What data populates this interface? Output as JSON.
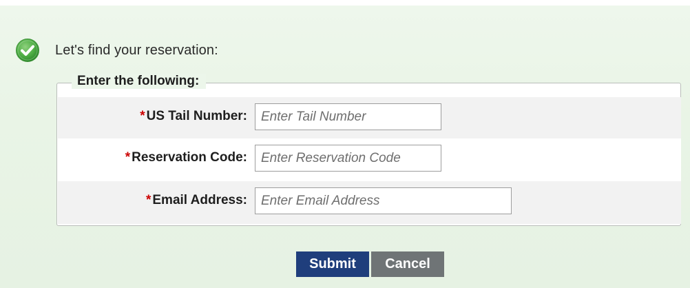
{
  "intro": {
    "text": "Let's find your reservation:",
    "icon": "check-circle-icon",
    "icon_color": "#4caf50"
  },
  "form": {
    "legend": "Enter the following:",
    "required_marker": "*",
    "fields": [
      {
        "label": "US Tail Number:",
        "placeholder": "Enter Tail Number",
        "value": ""
      },
      {
        "label": "Reservation Code:",
        "placeholder": "Enter Reservation Code",
        "value": ""
      },
      {
        "label": "Email Address:",
        "placeholder": "Enter Email Address",
        "value": ""
      }
    ]
  },
  "actions": {
    "submit_label": "Submit",
    "cancel_label": "Cancel",
    "submit_color": "#1f3e7c",
    "cancel_color": "#6f7476"
  }
}
